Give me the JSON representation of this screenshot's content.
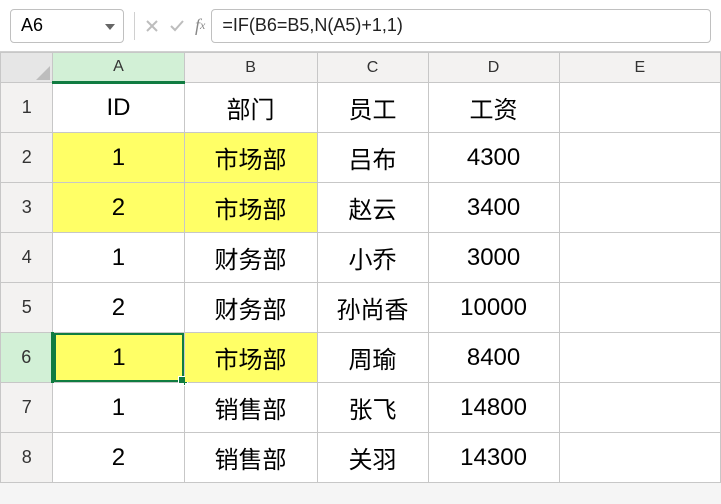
{
  "nameBox": {
    "value": "A6"
  },
  "formulaBar": {
    "value": "=IF(B6=B5,N(A5)+1,1)"
  },
  "columns": [
    "A",
    "B",
    "C",
    "D",
    "E"
  ],
  "selectedColumn": "A",
  "selectedRow": 6,
  "chart_data": {
    "type": "table",
    "headers": [
      "ID",
      "部门",
      "员工",
      "工资"
    ],
    "rows": [
      {
        "num": 1,
        "data": [
          "ID",
          "部门",
          "员工",
          "工资"
        ],
        "hl": []
      },
      {
        "num": 2,
        "data": [
          "1",
          "市场部",
          "吕布",
          "4300"
        ],
        "hl": [
          0,
          1
        ]
      },
      {
        "num": 3,
        "data": [
          "2",
          "市场部",
          "赵云",
          "3400"
        ],
        "hl": [
          0,
          1
        ]
      },
      {
        "num": 4,
        "data": [
          "1",
          "财务部",
          "小乔",
          "3000"
        ],
        "hl": []
      },
      {
        "num": 5,
        "data": [
          "2",
          "财务部",
          "孙尚香",
          "10000"
        ],
        "hl": []
      },
      {
        "num": 6,
        "data": [
          "1",
          "市场部",
          "周瑜",
          "8400"
        ],
        "hl": [
          0,
          1
        ]
      },
      {
        "num": 7,
        "data": [
          "1",
          "销售部",
          "张飞",
          "14800"
        ],
        "hl": []
      },
      {
        "num": 8,
        "data": [
          "2",
          "销售部",
          "关羽",
          "14300"
        ],
        "hl": []
      }
    ]
  }
}
